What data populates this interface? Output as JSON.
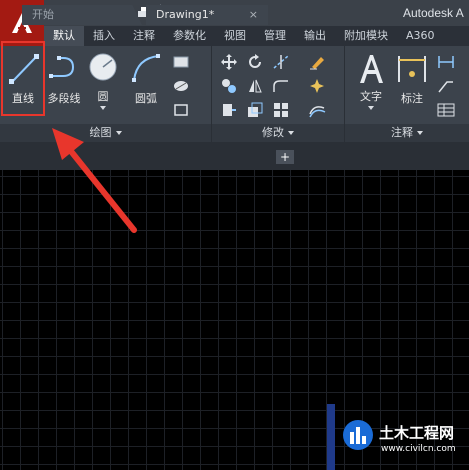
{
  "app": {
    "title": "Autodesk A"
  },
  "ribbon_tabs": [
    "默认",
    "插入",
    "注释",
    "参数化",
    "视图",
    "管理",
    "输出",
    "附加模块",
    "A360"
  ],
  "draw_panel": {
    "label": "绘图",
    "tools": {
      "line": "直线",
      "polyline": "多段线",
      "circle": "圆",
      "arc": "圆弧"
    }
  },
  "modify_panel": {
    "label": "修改"
  },
  "annotation_panel": {
    "label": "注释",
    "tools": {
      "text": "文字",
      "dimension": "标注"
    }
  },
  "doc_tabs": {
    "start": "开始",
    "drawing": "Drawing1*",
    "close_glyph": "×",
    "new_glyph": "+"
  },
  "watermark": {
    "title": "土木工程网",
    "url": "www.civilcn.com"
  },
  "colors": {
    "app_red": "#a31a12",
    "highlight_red": "#e8362c",
    "arrow_red": "#e8362c",
    "ribbon": "#3c434c"
  }
}
